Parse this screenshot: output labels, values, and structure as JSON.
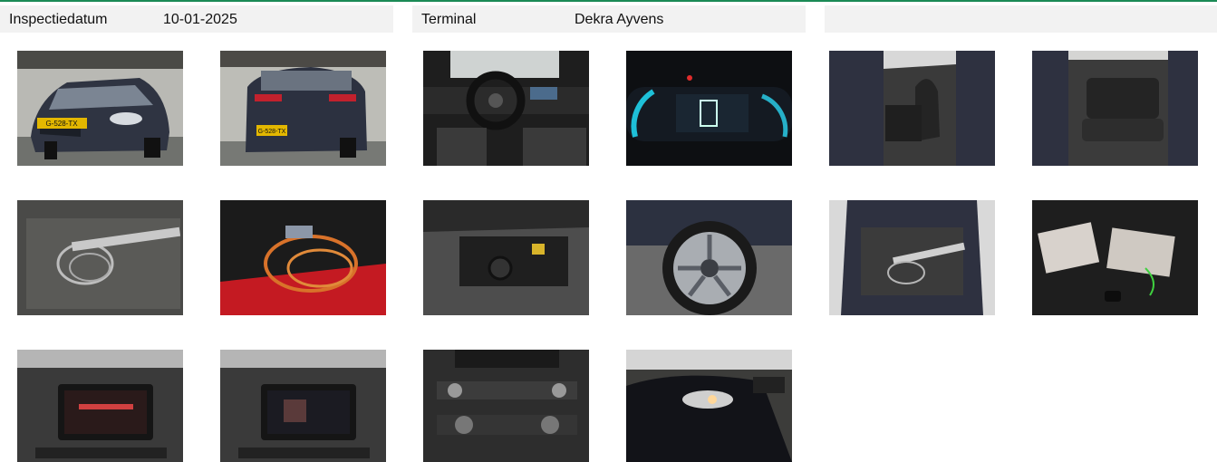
{
  "colors": {
    "accent": "#1a8a55",
    "header_bg": "#f2f2f2"
  },
  "header": {
    "inspection_label": "Inspectiedatum",
    "inspection_value": "10-01-2025",
    "terminal_label": "Terminal",
    "terminal_value": "Dekra Ayvens",
    "third_label": ""
  },
  "photos": [
    {
      "subject": "front-three-quarter",
      "plate": "G-528-TX"
    },
    {
      "subject": "rear-three-quarter",
      "plate": "G-528-TX"
    },
    {
      "subject": "dashboard-steering"
    },
    {
      "subject": "instrument-cluster"
    },
    {
      "subject": "front-seats"
    },
    {
      "subject": "rear-seats"
    },
    {
      "subject": "charging-cable-trunk"
    },
    {
      "subject": "orange-charging-cable"
    },
    {
      "subject": "spare-kit-compartment"
    },
    {
      "subject": "alloy-wheel"
    },
    {
      "subject": "open-trunk"
    },
    {
      "subject": "manuals-and-key"
    },
    {
      "subject": "infotainment-screen-1"
    },
    {
      "subject": "infotainment-screen-2"
    },
    {
      "subject": "center-console"
    },
    {
      "subject": "headlight"
    }
  ]
}
